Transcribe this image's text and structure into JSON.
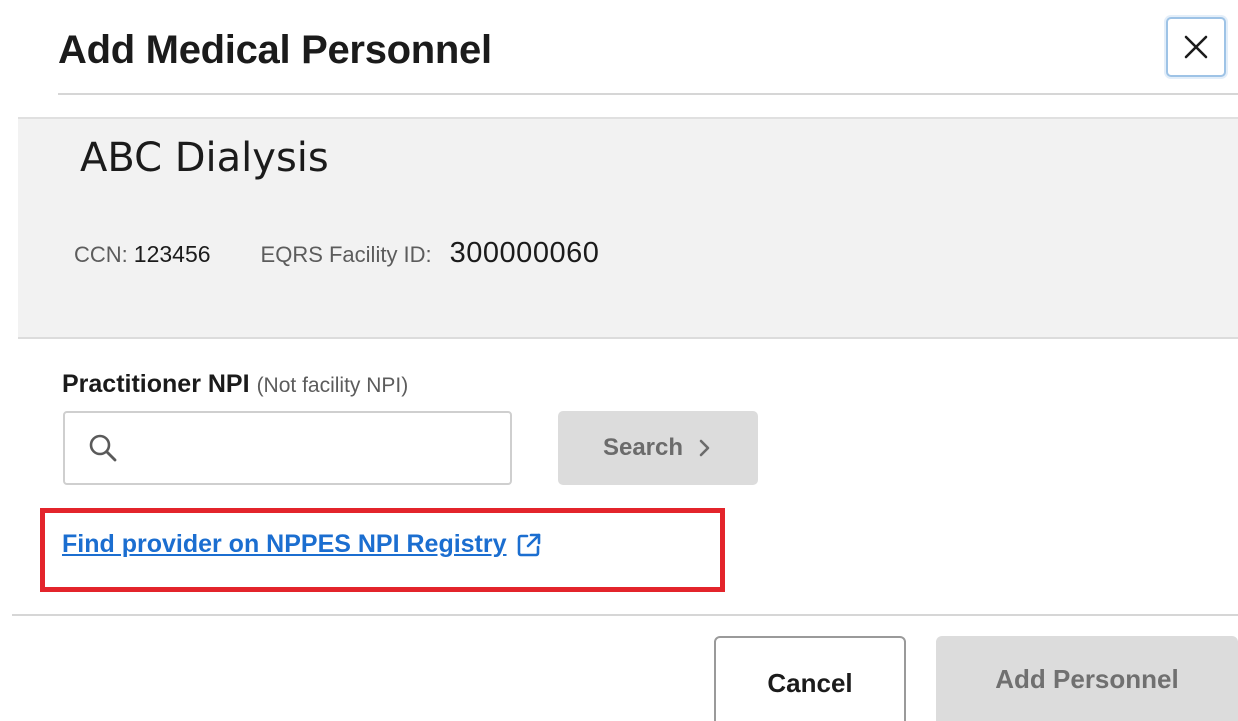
{
  "dialog": {
    "title": "Add Medical Personnel",
    "close_icon": "close-icon"
  },
  "facility": {
    "name": "ABC Dialysis",
    "ccn_label": "CCN:",
    "ccn_value": "123456",
    "eqrs_label": "EQRS Facility ID:",
    "eqrs_value": "300000060"
  },
  "npi_search": {
    "label": "Practitioner NPI",
    "label_note": "(Not facility NPI)",
    "input_value": "",
    "search_icon": "search-icon",
    "search_button_label": "Search",
    "search_button_icon": "chevron-right-icon"
  },
  "registry_link": {
    "label": "Find provider on NPPES NPI Registry",
    "icon": "external-link-icon",
    "highlight_color": "#e3242b"
  },
  "footer": {
    "cancel_label": "Cancel",
    "add_label": "Add Personnel"
  },
  "colors": {
    "link": "#1b6ed0",
    "disabled_button": "#dcdcdc",
    "panel_background": "#f2f2f2"
  }
}
